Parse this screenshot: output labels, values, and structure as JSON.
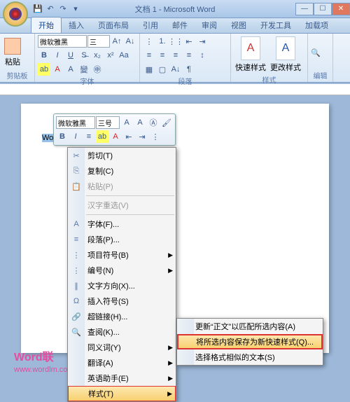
{
  "title": "文档 1 - Microsoft Word",
  "tabs": [
    "开始",
    "插入",
    "页面布局",
    "引用",
    "邮件",
    "审阅",
    "视图",
    "开发工具",
    "加载项"
  ],
  "active_tab": 0,
  "ribbon": {
    "clipboard": {
      "label": "剪贴板",
      "paste": "粘贴"
    },
    "font": {
      "label": "字体",
      "family": "微软雅黑",
      "size": "三"
    },
    "paragraph": {
      "label": "段落"
    },
    "styles": {
      "label": "样式",
      "quick": "快速样式",
      "change": "更改样式"
    },
    "editing": {
      "label": "编辑"
    }
  },
  "mini_toolbar": {
    "font": "微软雅黑",
    "size": "三号"
  },
  "document": {
    "selected_text": "Word 联"
  },
  "context_menu": [
    {
      "icon": "✂",
      "label": "剪切(T)"
    },
    {
      "icon": "⎘",
      "label": "复制(C)"
    },
    {
      "icon": "📋",
      "label": "粘贴(P)",
      "disabled": true
    },
    {
      "sep": true
    },
    {
      "icon": "",
      "label": "汉字重选(V)",
      "disabled": true
    },
    {
      "sep": true
    },
    {
      "icon": "A",
      "label": "字体(F)..."
    },
    {
      "icon": "≡",
      "label": "段落(P)..."
    },
    {
      "icon": "⋮",
      "label": "项目符号(B)",
      "sub": true
    },
    {
      "icon": "⋮",
      "label": "编号(N)",
      "sub": true
    },
    {
      "icon": "∥",
      "label": "文字方向(X)..."
    },
    {
      "icon": "Ω",
      "label": "插入符号(S)"
    },
    {
      "icon": "🔗",
      "label": "超链接(H)..."
    },
    {
      "icon": "🔍",
      "label": "查阅(K)..."
    },
    {
      "icon": "",
      "label": "同义词(Y)",
      "sub": true
    },
    {
      "icon": "",
      "label": "翻译(A)",
      "sub": true
    },
    {
      "icon": "",
      "label": "英语助手(E)",
      "sub": true
    },
    {
      "icon": "",
      "label": "样式(T)",
      "sub": true,
      "hl": true
    }
  ],
  "submenu": [
    {
      "label": "更新“正文”以匹配所选内容(A)"
    },
    {
      "label": "将所选内容保存为新快速样式(Q)...",
      "hl": true
    },
    {
      "label": "选择格式相似的文本(S)"
    }
  ],
  "watermark": {
    "line1": "Word联",
    "line2": "www.wordlm.com"
  }
}
